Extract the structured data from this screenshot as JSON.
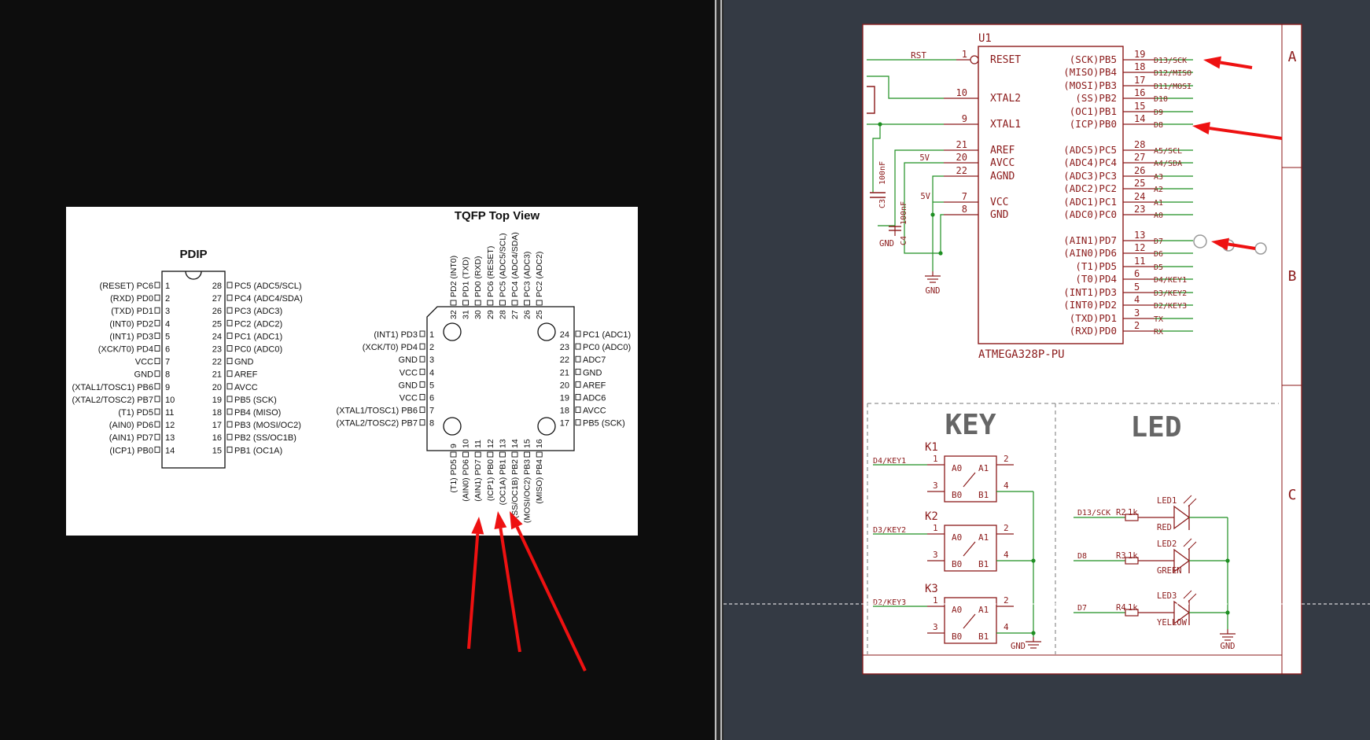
{
  "datasheet": {
    "pdip_title": "PDIP",
    "tqfp_title": "TQFP Top View",
    "pdip_left_pins": [
      {
        "name": "(RESET) PC6",
        "num": "1"
      },
      {
        "name": "(RXD) PD0",
        "num": "2"
      },
      {
        "name": "(TXD) PD1",
        "num": "3"
      },
      {
        "name": "(INT0) PD2",
        "num": "4"
      },
      {
        "name": "(INT1) PD3",
        "num": "5"
      },
      {
        "name": "(XCK/T0) PD4",
        "num": "6"
      },
      {
        "name": "VCC",
        "num": "7"
      },
      {
        "name": "GND",
        "num": "8"
      },
      {
        "name": "(XTAL1/TOSC1) PB6",
        "num": "9"
      },
      {
        "name": "(XTAL2/TOSC2) PB7",
        "num": "10"
      },
      {
        "name": "(T1) PD5",
        "num": "11"
      },
      {
        "name": "(AIN0) PD6",
        "num": "12"
      },
      {
        "name": "(AIN1) PD7",
        "num": "13"
      },
      {
        "name": "(ICP1) PB0",
        "num": "14"
      }
    ],
    "pdip_right_pins": [
      {
        "num": "28",
        "name": "PC5 (ADC5/SCL)"
      },
      {
        "num": "27",
        "name": "PC4 (ADC4/SDA)"
      },
      {
        "num": "26",
        "name": "PC3 (ADC3)"
      },
      {
        "num": "25",
        "name": "PC2 (ADC2)"
      },
      {
        "num": "24",
        "name": "PC1 (ADC1)"
      },
      {
        "num": "23",
        "name": "PC0 (ADC0)"
      },
      {
        "num": "22",
        "name": "GND"
      },
      {
        "num": "21",
        "name": "AREF"
      },
      {
        "num": "20",
        "name": "AVCC"
      },
      {
        "num": "19",
        "name": "PB5 (SCK)"
      },
      {
        "num": "18",
        "name": "PB4 (MISO)"
      },
      {
        "num": "17",
        "name": "PB3 (MOSI/OC2)"
      },
      {
        "num": "16",
        "name": "PB2 (SS/OC1B)"
      },
      {
        "num": "15",
        "name": "PB1 (OC1A)"
      }
    ],
    "tqfp_left_pins": [
      {
        "name": "(INT1) PD3",
        "num": "1"
      },
      {
        "name": "(XCK/T0) PD4",
        "num": "2"
      },
      {
        "name": "GND",
        "num": "3"
      },
      {
        "name": "VCC",
        "num": "4"
      },
      {
        "name": "GND",
        "num": "5"
      },
      {
        "name": "VCC",
        "num": "6"
      },
      {
        "name": "(XTAL1/TOSC1) PB6",
        "num": "7"
      },
      {
        "name": "(XTAL2/TOSC2) PB7",
        "num": "8"
      }
    ],
    "tqfp_right_pins": [
      {
        "num": "24",
        "name": "PC1 (ADC1)"
      },
      {
        "num": "23",
        "name": "PC0 (ADC0)"
      },
      {
        "num": "22",
        "name": "ADC7"
      },
      {
        "num": "21",
        "name": "GND"
      },
      {
        "num": "20",
        "name": "AREF"
      },
      {
        "num": "19",
        "name": "ADC6"
      },
      {
        "num": "18",
        "name": "AVCC"
      },
      {
        "num": "17",
        "name": "PB5 (SCK)"
      }
    ],
    "tqfp_top_pins": [
      {
        "num": "32",
        "name": "PD2 (INT0)"
      },
      {
        "num": "31",
        "name": "PD1 (TXD)"
      },
      {
        "num": "30",
        "name": "PD0 (RXD)"
      },
      {
        "num": "29",
        "name": "PC6 (RESET)"
      },
      {
        "num": "28",
        "name": "PC5 (ADC5/SCL)"
      },
      {
        "num": "27",
        "name": "PC4 (ADC4/SDA)"
      },
      {
        "num": "26",
        "name": "PC3 (ADC3)"
      },
      {
        "num": "25",
        "name": "PC2 (ADC2)"
      }
    ],
    "tqfp_bottom_pins": [
      {
        "num": "9",
        "name": "(T1) PD5"
      },
      {
        "num": "10",
        "name": "(AIN0) PD6"
      },
      {
        "num": "11",
        "name": "(AIN1) PD7"
      },
      {
        "num": "12",
        "name": "(ICP1) PB0"
      },
      {
        "num": "13",
        "name": "(OC1A) PB1"
      },
      {
        "num": "14",
        "name": "(SS/OC1B) PB2"
      },
      {
        "num": "15",
        "name": "(MOSI/OC2) PB3"
      },
      {
        "num": "16",
        "name": "(MISO) PB4"
      }
    ]
  },
  "schematic": {
    "ref": "U1",
    "part": "ATMEGA328P-PU",
    "rst_label": "RST",
    "left_pins": [
      {
        "num": "1",
        "name": "RESET"
      },
      {
        "num": "10",
        "name": "XTAL2"
      },
      {
        "num": "9",
        "name": "XTAL1"
      },
      {
        "num": "21",
        "name": "AREF"
      },
      {
        "num": "20",
        "name": "AVCC"
      },
      {
        "num": "22",
        "name": "AGND"
      },
      {
        "num": "7",
        "name": "VCC"
      },
      {
        "num": "8",
        "name": "GND"
      }
    ],
    "right_pins": [
      {
        "name": "(SCK)PB5",
        "num": "19",
        "net": "D13/SCK"
      },
      {
        "name": "(MISO)PB4",
        "num": "18",
        "net": "D12/MISO"
      },
      {
        "name": "(MOSI)PB3",
        "num": "17",
        "net": "D11/MOSI"
      },
      {
        "name": "(SS)PB2",
        "num": "16",
        "net": "D10"
      },
      {
        "name": "(OC1)PB1",
        "num": "15",
        "net": "D9"
      },
      {
        "name": "(ICP)PB0",
        "num": "14",
        "net": "D8"
      },
      {
        "name": "(ADC5)PC5",
        "num": "28",
        "net": "A5/SCL"
      },
      {
        "name": "(ADC4)PC4",
        "num": "27",
        "net": "A4/SDA"
      },
      {
        "name": "(ADC3)PC3",
        "num": "26",
        "net": "A3"
      },
      {
        "name": "(ADC2)PC2",
        "num": "25",
        "net": "A2"
      },
      {
        "name": "(ADC1)PC1",
        "num": "24",
        "net": "A1"
      },
      {
        "name": "(ADC0)PC0",
        "num": "23",
        "net": "A0"
      },
      {
        "name": "(AIN1)PD7",
        "num": "13",
        "net": "D7"
      },
      {
        "name": "(AIN0)PD6",
        "num": "12",
        "net": "D6"
      },
      {
        "name": "(T1)PD5",
        "num": "11",
        "net": "D5"
      },
      {
        "name": "(T0)PD4",
        "num": "6",
        "net": "D4/KEY1"
      },
      {
        "name": "(INT1)PD3",
        "num": "5",
        "net": "D3/KEY2"
      },
      {
        "name": "(INT0)PD2",
        "num": "4",
        "net": "D2/KEY3"
      },
      {
        "name": "(TXD)PD1",
        "num": "3",
        "net": "TX"
      },
      {
        "name": "(RXD)PD0",
        "num": "2",
        "net": "RX"
      }
    ],
    "power_5v": "5V",
    "gnd": "GND",
    "c3": {
      "ref": "C3",
      "value": "100nF"
    },
    "c4": {
      "ref": "C4",
      "value": "100nF"
    },
    "frame_rows": [
      "A",
      "B",
      "C"
    ],
    "key": {
      "title": "KEY",
      "switches": [
        {
          "ref": "K1",
          "net": "D4/KEY1"
        },
        {
          "ref": "K2",
          "net": "D3/KEY2"
        },
        {
          "ref": "K3",
          "net": "D2/KEY3"
        }
      ],
      "pin_a0": "A0",
      "pin_a1": "A1",
      "pin_b0": "B0",
      "pin_b1": "B1",
      "pin1": "1",
      "pin2": "2",
      "pin3": "3",
      "pin4": "4"
    },
    "led": {
      "title": "LED",
      "items": [
        {
          "ref": "LED1",
          "net": "D13/SCK",
          "res": "R2",
          "res_val": "1k",
          "color": "RED"
        },
        {
          "ref": "LED2",
          "net": "D8",
          "res": "R3",
          "res_val": "1k",
          "color": "GREEN"
        },
        {
          "ref": "LED3",
          "net": "D7",
          "res": "R4",
          "res_val": "1k",
          "color": "YELLOW"
        }
      ]
    }
  }
}
